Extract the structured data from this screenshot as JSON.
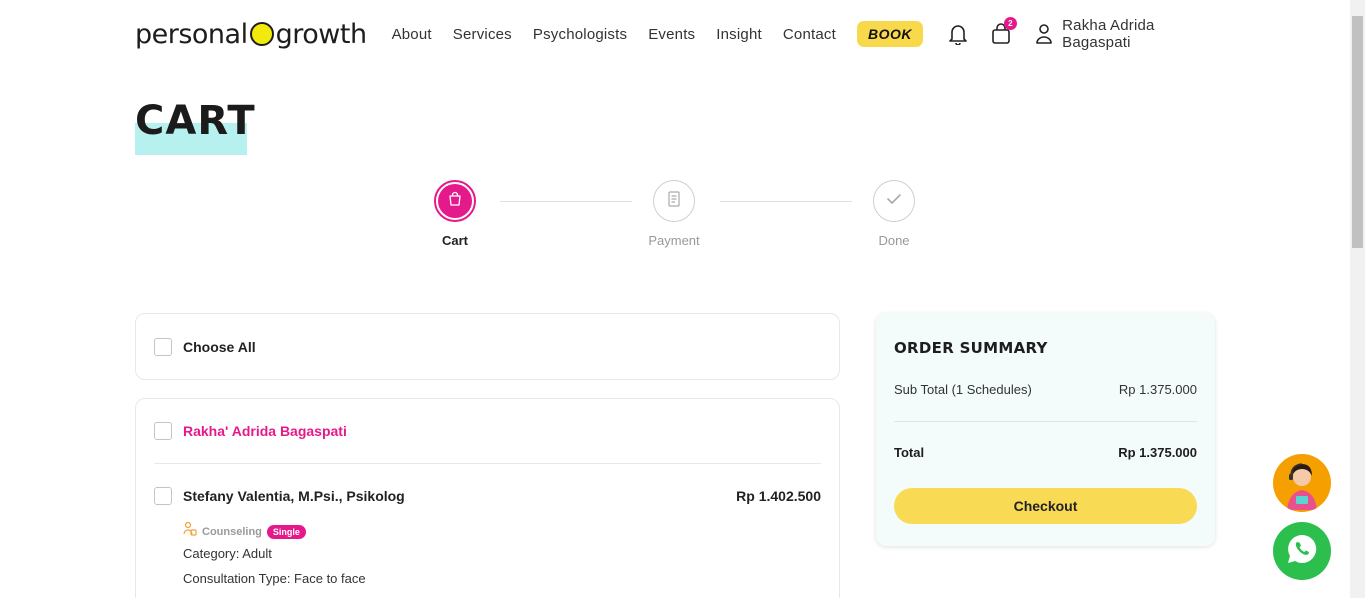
{
  "header": {
    "logo_left": "personal",
    "logo_right": "growth",
    "nav": [
      "About",
      "Services",
      "Psychologists",
      "Events",
      "Insight",
      "Contact"
    ],
    "book_label": "BOOK",
    "cart_count": "2",
    "user_name": "Rakha Adrida Bagaspati"
  },
  "page": {
    "title": "CART"
  },
  "stepper": {
    "steps": [
      "Cart",
      "Payment",
      "Done"
    ],
    "active": "Cart"
  },
  "cart": {
    "choose_all_label": "Choose All",
    "group": {
      "owner": "Rakha' Adrida Bagaspati",
      "item": {
        "psychologist": "Stefany Valentia, M.Psi., Psikolog",
        "price": "Rp 1.402.500",
        "service": "Counseling",
        "service_badge": "Single",
        "category": "Category: Adult",
        "consultation_type": "Consultation Type: Face to face"
      }
    }
  },
  "summary": {
    "title": "ORDER SUMMARY",
    "subtotal_label": "Sub Total (1 Schedules)",
    "subtotal_value": "Rp 1.375.000",
    "total_label": "Total",
    "total_value": "Rp 1.375.000",
    "checkout_label": "Checkout"
  },
  "colors": {
    "accent_pink": "#e6198c",
    "accent_yellow": "#f9da55",
    "title_highlight": "#b6f0ef",
    "whatsapp": "#2cbf4e"
  },
  "icons": [
    "bell-icon",
    "cart-icon",
    "user-icon",
    "shopping-bag-icon",
    "receipt-icon",
    "check-icon",
    "service-icon",
    "assistant-icon",
    "whatsapp-icon"
  ]
}
